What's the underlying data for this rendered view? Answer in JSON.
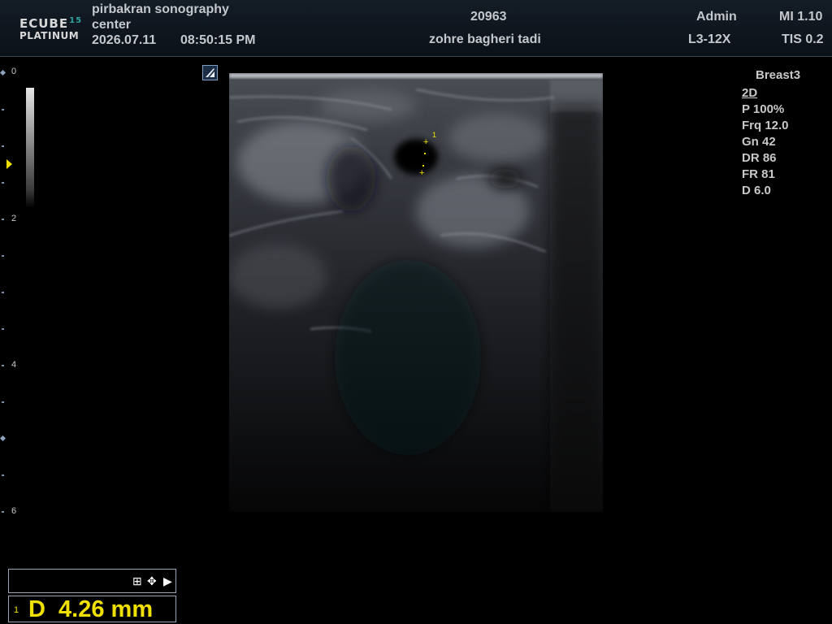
{
  "header": {
    "logo_top": "ECUBE",
    "logo_top_num": "15",
    "logo_bottom": "PLATINUM",
    "center_line1": "pirbakran sonography",
    "center_line2": "center",
    "date": "2026.07.11",
    "time": "08:50:15  PM",
    "patient_id": "20963",
    "patient_name": "zohre bagheri tadi",
    "operator": "Admin",
    "probe": "L3-12X",
    "mi": "MI 1.10",
    "tis": "TIS 0.2"
  },
  "depth_scale": {
    "labels": [
      "0",
      "2",
      "4",
      "6"
    ]
  },
  "parameters": {
    "preset": "Breast3",
    "mode": "2D",
    "power": "P 100%",
    "frequency": "Frq 12.0",
    "gain": "Gn 42",
    "dynamic_range": "DR 86",
    "frame_rate": "FR 81",
    "depth": "D 6.0"
  },
  "caliper": {
    "index": "1"
  },
  "measurement": {
    "index": "1",
    "value": "D  4.26 mm"
  },
  "controls": {
    "grid_icon": "grid-icon",
    "move_icon": "move-icon",
    "next_icon": "play-arrow-icon"
  },
  "colors": {
    "measurement": "#f0e000",
    "header_bg": "#0f1620"
  }
}
